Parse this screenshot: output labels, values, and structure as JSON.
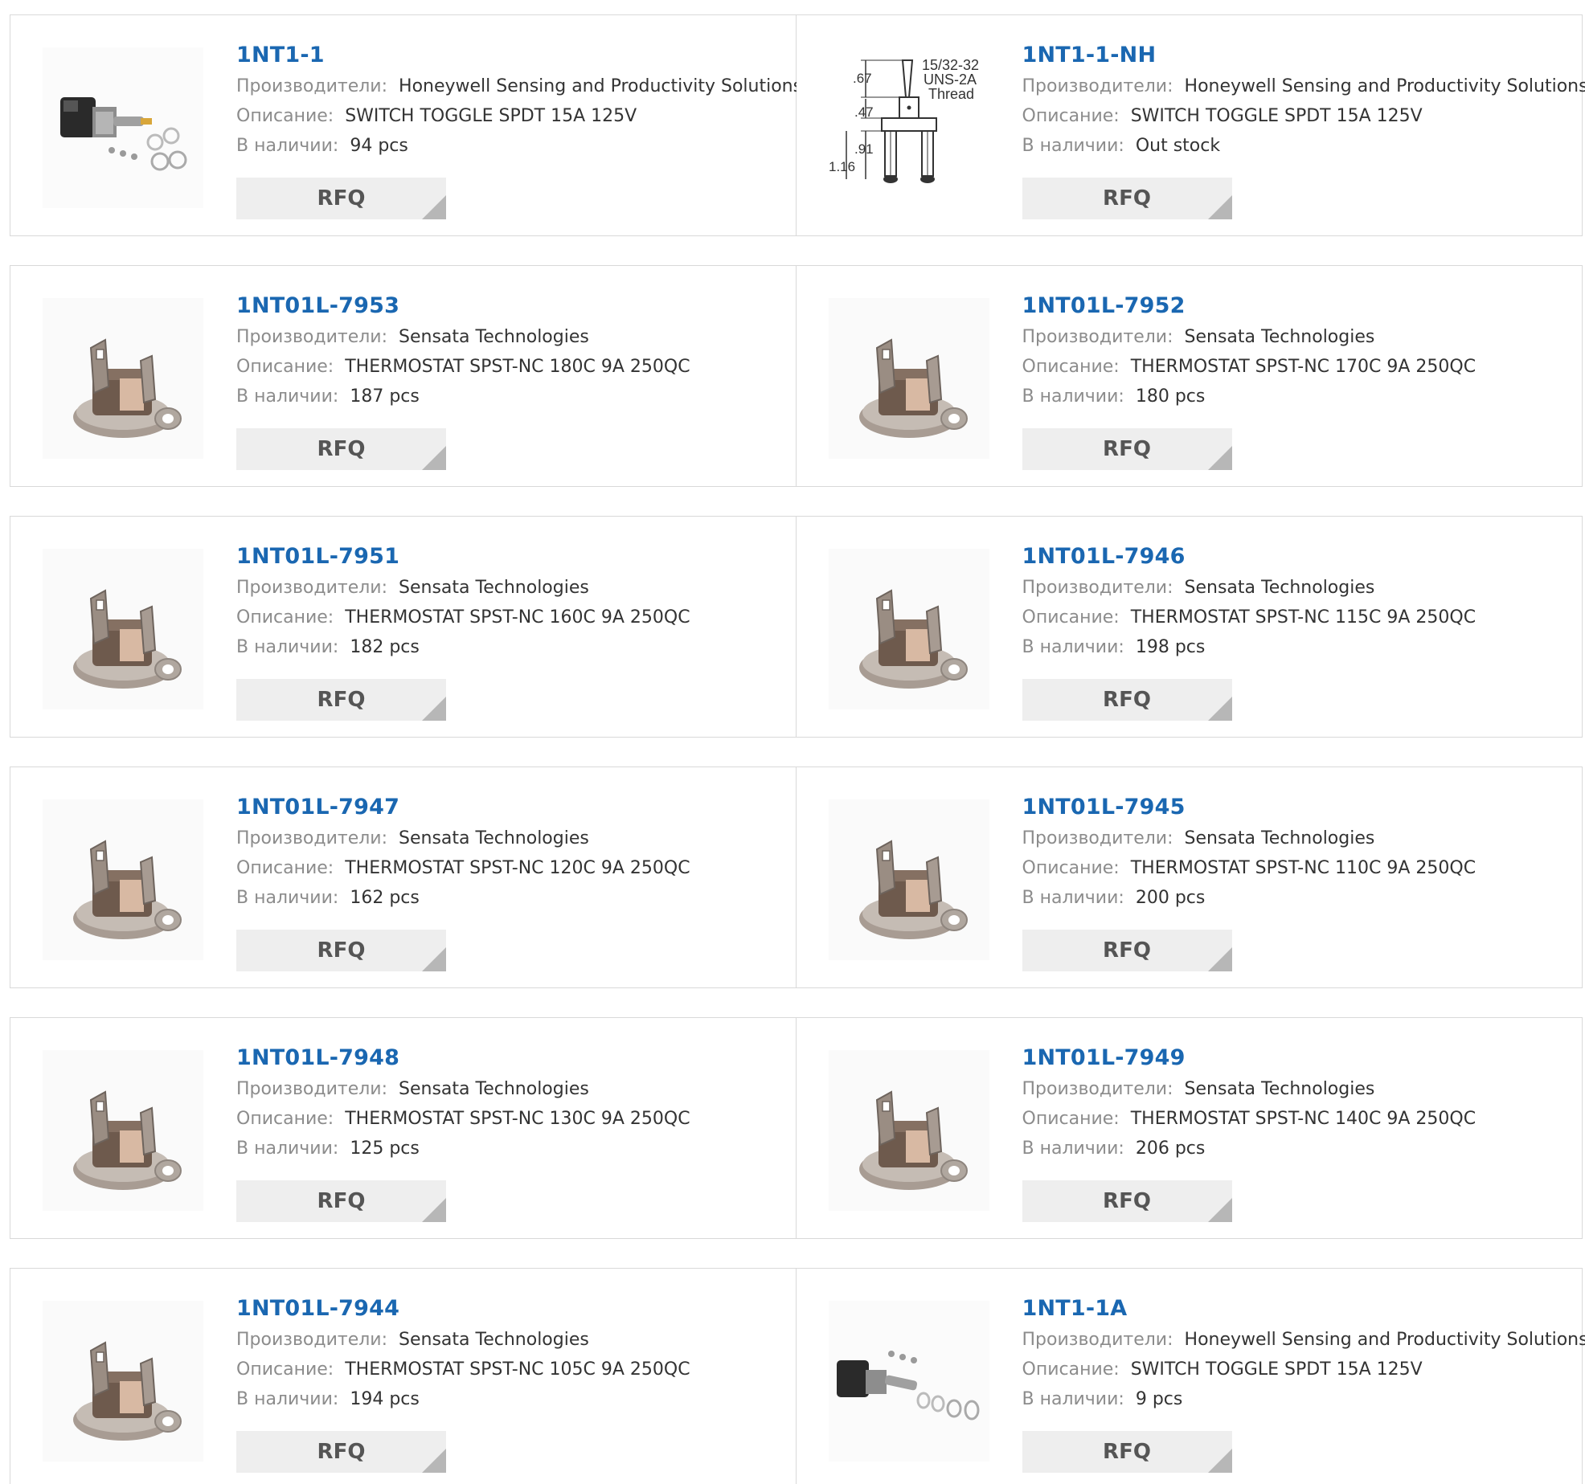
{
  "labels": {
    "manufacturer": "Производители:",
    "description": "Описание:",
    "stock": "В наличии:",
    "rfq": "RFQ"
  },
  "products": [
    {
      "part": "1NT1-1",
      "manufacturer": "Honeywell Sensing and Productivity Solutions",
      "description": "SWITCH TOGGLE SPDT 15A 125V",
      "stock": "94 pcs",
      "image": "toggle-switch-photo-icon"
    },
    {
      "part": "1NT1-1-NH",
      "manufacturer": "Honeywell Sensing and Productivity Solutions",
      "description": "SWITCH TOGGLE SPDT 15A 125V",
      "stock": "Out stock",
      "image": "toggle-switch-drawing-icon",
      "drawing": {
        "d1": ".67",
        "d2": ".47",
        "d3": ".91",
        "d4": "1.16",
        "t1": "15/32-32",
        "t2": "UNS-2A",
        "t3": "Thread"
      }
    },
    {
      "part": "1NT01L-7953",
      "manufacturer": "Sensata Technologies",
      "description": "THERMOSTAT SPST-NC 180C 9A 250QC",
      "stock": "187 pcs",
      "image": "thermostat-icon"
    },
    {
      "part": "1NT01L-7952",
      "manufacturer": "Sensata Technologies",
      "description": "THERMOSTAT SPST-NC 170C 9A 250QC",
      "stock": "180 pcs",
      "image": "thermostat-icon"
    },
    {
      "part": "1NT01L-7951",
      "manufacturer": "Sensata Technologies",
      "description": "THERMOSTAT SPST-NC 160C 9A 250QC",
      "stock": "182 pcs",
      "image": "thermostat-icon"
    },
    {
      "part": "1NT01L-7946",
      "manufacturer": "Sensata Technologies",
      "description": "THERMOSTAT SPST-NC 115C 9A 250QC",
      "stock": "198 pcs",
      "image": "thermostat-icon"
    },
    {
      "part": "1NT01L-7947",
      "manufacturer": "Sensata Technologies",
      "description": "THERMOSTAT SPST-NC 120C 9A 250QC",
      "stock": "162 pcs",
      "image": "thermostat-icon"
    },
    {
      "part": "1NT01L-7945",
      "manufacturer": "Sensata Technologies",
      "description": "THERMOSTAT SPST-NC 110C 9A 250QC",
      "stock": "200 pcs",
      "image": "thermostat-icon"
    },
    {
      "part": "1NT01L-7948",
      "manufacturer": "Sensata Technologies",
      "description": "THERMOSTAT SPST-NC 130C 9A 250QC",
      "stock": "125 pcs",
      "image": "thermostat-icon"
    },
    {
      "part": "1NT01L-7949",
      "manufacturer": "Sensata Technologies",
      "description": "THERMOSTAT SPST-NC 140C 9A 250QC",
      "stock": "206 pcs",
      "image": "thermostat-icon"
    },
    {
      "part": "1NT01L-7944",
      "manufacturer": "Sensata Technologies",
      "description": "THERMOSTAT SPST-NC 105C 9A 250QC",
      "stock": "194 pcs",
      "image": "thermostat-icon"
    },
    {
      "part": "1NT1-1A",
      "manufacturer": "Honeywell Sensing and Productivity Solutions",
      "description": "SWITCH TOGGLE SPDT 15A 125V",
      "stock": "9 pcs",
      "image": "toggle-switch-kit-icon"
    }
  ],
  "colors": {
    "part_link": "#1a67b1",
    "label": "#8c8c8c",
    "value": "#333333",
    "border": "#d9d9d9",
    "rfq_bg": "#eeeeee",
    "rfq_corner": "#b7b7b7"
  }
}
